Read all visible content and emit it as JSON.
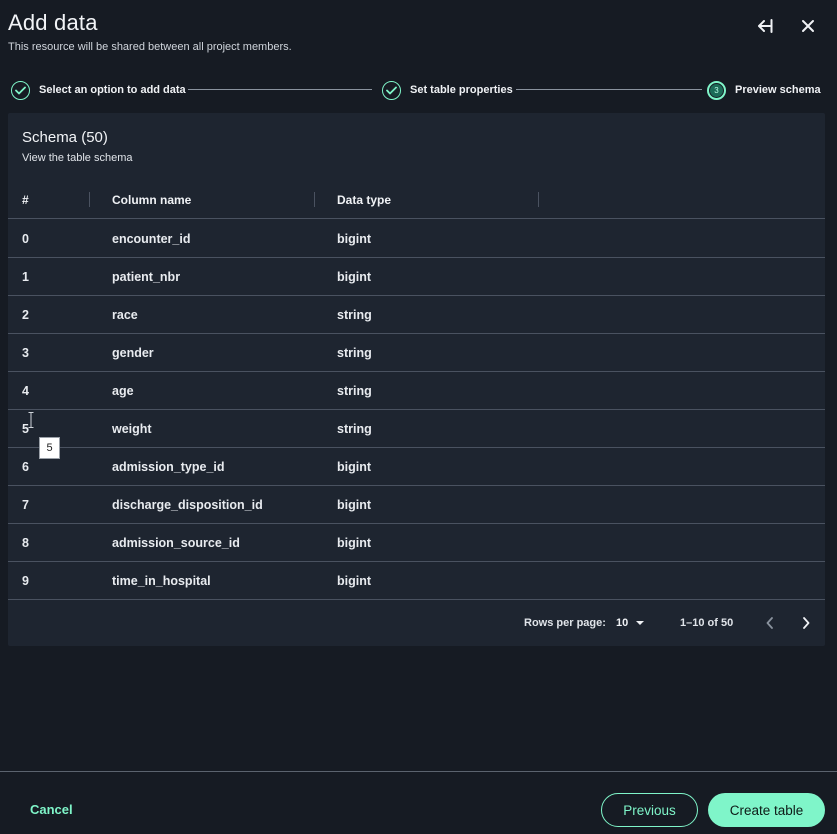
{
  "header": {
    "title": "Add data",
    "subtitle": "This resource will be shared between all project members."
  },
  "stepper": {
    "steps": [
      {
        "label": "Select an option to add data",
        "status": "complete"
      },
      {
        "label": "Set table properties",
        "status": "complete"
      },
      {
        "label": "Preview schema",
        "status": "current",
        "number": "3"
      }
    ]
  },
  "schema": {
    "title": "Schema (50)",
    "description": "View the table schema",
    "columns": [
      "#",
      "Column name",
      "Data type"
    ],
    "rows": [
      {
        "num": "0",
        "name": "encounter_id",
        "type": "bigint"
      },
      {
        "num": "1",
        "name": "patient_nbr",
        "type": "bigint"
      },
      {
        "num": "2",
        "name": "race",
        "type": "string"
      },
      {
        "num": "3",
        "name": "gender",
        "type": "string"
      },
      {
        "num": "4",
        "name": "age",
        "type": "string"
      },
      {
        "num": "5",
        "name": "weight",
        "type": "string"
      },
      {
        "num": "6",
        "name": "admission_type_id",
        "type": "bigint"
      },
      {
        "num": "7",
        "name": "discharge_disposition_id",
        "type": "bigint"
      },
      {
        "num": "8",
        "name": "admission_source_id",
        "type": "bigint"
      },
      {
        "num": "9",
        "name": "time_in_hospital",
        "type": "bigint"
      }
    ],
    "tooltip": "5"
  },
  "pagination": {
    "rows_per_page_label": "Rows per page:",
    "rows_per_page_value": "10",
    "range": "1–10 of 50"
  },
  "footer": {
    "cancel": "Cancel",
    "previous": "Previous",
    "create": "Create table"
  },
  "colors": {
    "accent": "#7ff5c9",
    "background": "#161b23",
    "panel": "#1e2530"
  }
}
